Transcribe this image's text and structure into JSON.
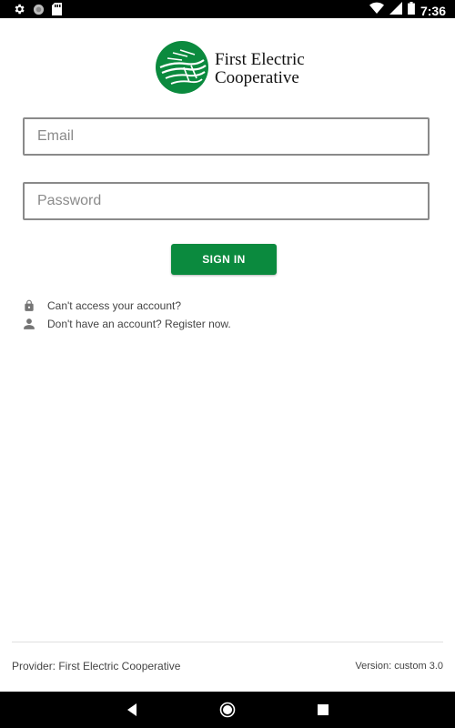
{
  "status_bar": {
    "time": "7:36",
    "left_icons": [
      "settings-icon",
      "notification-dot-icon",
      "sd-card-icon"
    ],
    "right_icons": [
      "wifi-icon",
      "signal-icon",
      "battery-icon"
    ]
  },
  "logo": {
    "line1": "First Electric",
    "line2": "Cooperative",
    "brand_color": "#0b8a3e"
  },
  "form": {
    "email_placeholder": "Email",
    "password_placeholder": "Password",
    "signin_label": "SIGN IN"
  },
  "links": {
    "cant_access": "Can't access your account?",
    "register": "Don't have an account? Register now."
  },
  "footer": {
    "provider": "Provider: First Electric Cooperative",
    "version": "Version: custom 3.0"
  },
  "nav_bar": {
    "buttons": [
      "back-icon",
      "home-icon",
      "recents-icon"
    ]
  }
}
